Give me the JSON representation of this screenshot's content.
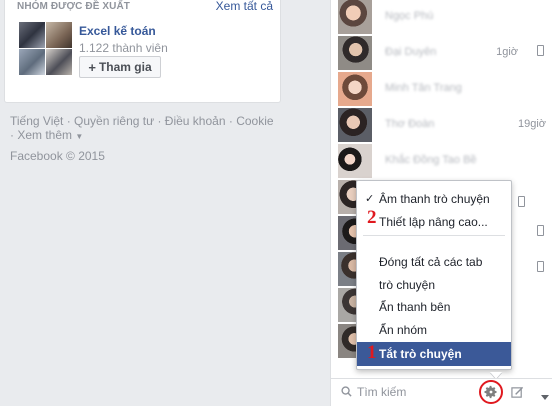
{
  "suggested_groups": {
    "title": "NHÓM ĐƯỢC ĐỀ XUẤT",
    "see_all": "Xem tất cả",
    "group": {
      "name": "Excel kế toán",
      "members": "1.122 thành viên",
      "join_label": "Tham gia",
      "join_icon": "plus-icon"
    }
  },
  "footer": {
    "links": [
      "Tiếng Việt",
      "Quyền riêng tư",
      "Điều khoản",
      "Cookie",
      "Xem thêm"
    ],
    "copyright": "Facebook © 2015"
  },
  "chat": {
    "contacts": [
      {
        "name": "Ngọc Phú",
        "time": "",
        "mobile": false
      },
      {
        "name": "Đại Duyên",
        "time": "1giờ",
        "mobile": true
      },
      {
        "name": "Minh Tân Trang",
        "time": "",
        "mobile": false
      },
      {
        "name": "Thơ Đoàn",
        "time": "19giờ",
        "mobile": false
      },
      {
        "name": "Khắc Đồng Tao Bề",
        "time": "",
        "mobile": false
      },
      {
        "name": "",
        "time": "",
        "mobile": true
      },
      {
        "name": "",
        "time": "",
        "mobile": true
      },
      {
        "name": "",
        "time": "",
        "mobile": false
      },
      {
        "name": "",
        "time": "",
        "mobile": true
      },
      {
        "name": "",
        "time": "",
        "mobile": false
      },
      {
        "name": "",
        "time": "",
        "mobile": false
      }
    ],
    "search_placeholder": "Tìm kiếm",
    "menu": {
      "items": [
        "Âm thanh trò chuyện",
        "Thiết lập nâng cao...",
        "Đóng tất cả các tab trò chuyện",
        "Ẩn thanh bên",
        "Ẩn nhóm",
        "Tắt trò chuyện"
      ],
      "checked_index": 0,
      "highlighted_index": 5,
      "markers": [
        "1",
        "2"
      ]
    },
    "icons": {
      "search": "search-icon",
      "settings": "gear-icon",
      "compose": "compose-icon"
    },
    "colors": {
      "highlight": "#3b5998",
      "annotation": "#e0191f",
      "link": "#365899"
    }
  }
}
